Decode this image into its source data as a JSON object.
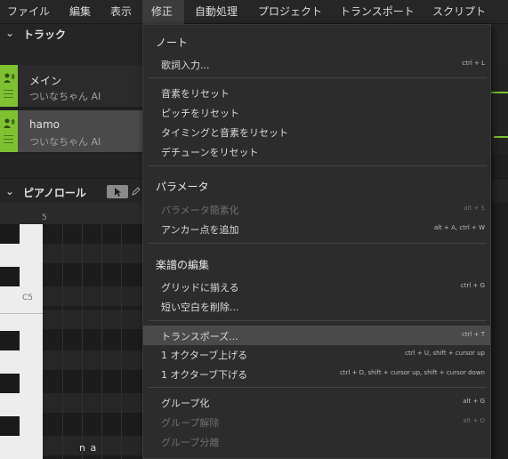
{
  "menubar": {
    "items": [
      {
        "label": "ファイル"
      },
      {
        "label": "編集"
      },
      {
        "label": "表示"
      },
      {
        "label": "修正"
      },
      {
        "label": "自動処理"
      },
      {
        "label": "プロジェクト"
      },
      {
        "label": "トランスポート"
      },
      {
        "label": "スクリプト"
      }
    ],
    "active_index": 3
  },
  "tracks_panel": {
    "title": "トラック",
    "tracks": [
      {
        "name": "メイン",
        "voice": "ついなちゃん AI",
        "selected": false
      },
      {
        "name": "hamo",
        "voice": "ついなちゃん AI",
        "selected": true
      }
    ]
  },
  "piano_roll": {
    "title": "ピアノロール",
    "measure_number": "5",
    "octave_label": "C5",
    "lyric": "n a"
  },
  "colors": {
    "accent": "#7ec232",
    "menu_bg": "#2c2c2c",
    "highlight": "#4a4a4a"
  },
  "menu": {
    "sections": [
      {
        "title": "ノート",
        "items": [
          {
            "label": "歌詞入力...",
            "shortcut": "ctrl + L",
            "disabled": false
          }
        ]
      },
      {
        "title": "",
        "items": [
          {
            "label": "音素をリセット",
            "shortcut": "",
            "disabled": false
          },
          {
            "label": "ピッチをリセット",
            "shortcut": "",
            "disabled": false
          },
          {
            "label": "タイミングと音素をリセット",
            "shortcut": "",
            "disabled": false
          },
          {
            "label": "デチューンをリセット",
            "shortcut": "",
            "disabled": false
          }
        ]
      },
      {
        "title": "パラメータ",
        "items": [
          {
            "label": "パラメータ簡素化",
            "shortcut": "alt + S",
            "disabled": true
          },
          {
            "label": "アンカー点を追加",
            "shortcut": "alt + A, ctrl + W",
            "disabled": false
          }
        ]
      },
      {
        "title": "楽譜の編集",
        "items": [
          {
            "label": "グリッドに揃える",
            "shortcut": "ctrl + G",
            "disabled": false
          },
          {
            "label": "短い空白を削除...",
            "shortcut": "",
            "disabled": false
          }
        ]
      },
      {
        "title": "",
        "items": [
          {
            "label": "トランスポーズ...",
            "shortcut": "ctrl + T",
            "disabled": false,
            "highlighted": true
          },
          {
            "label": "1 オクターブ上げる",
            "shortcut": "ctrl + U, shift + cursor up",
            "disabled": false
          },
          {
            "label": "1 オクターブ下げる",
            "shortcut": "ctrl + D, shift + cursor up, shift + cursor down",
            "disabled": false
          }
        ]
      },
      {
        "title": "",
        "items": [
          {
            "label": "グループ化",
            "shortcut": "alt + G",
            "disabled": false
          },
          {
            "label": "グループ解除",
            "shortcut": "alt + D",
            "disabled": true
          },
          {
            "label": "グループ分離",
            "shortcut": "",
            "disabled": true
          }
        ]
      }
    ]
  }
}
